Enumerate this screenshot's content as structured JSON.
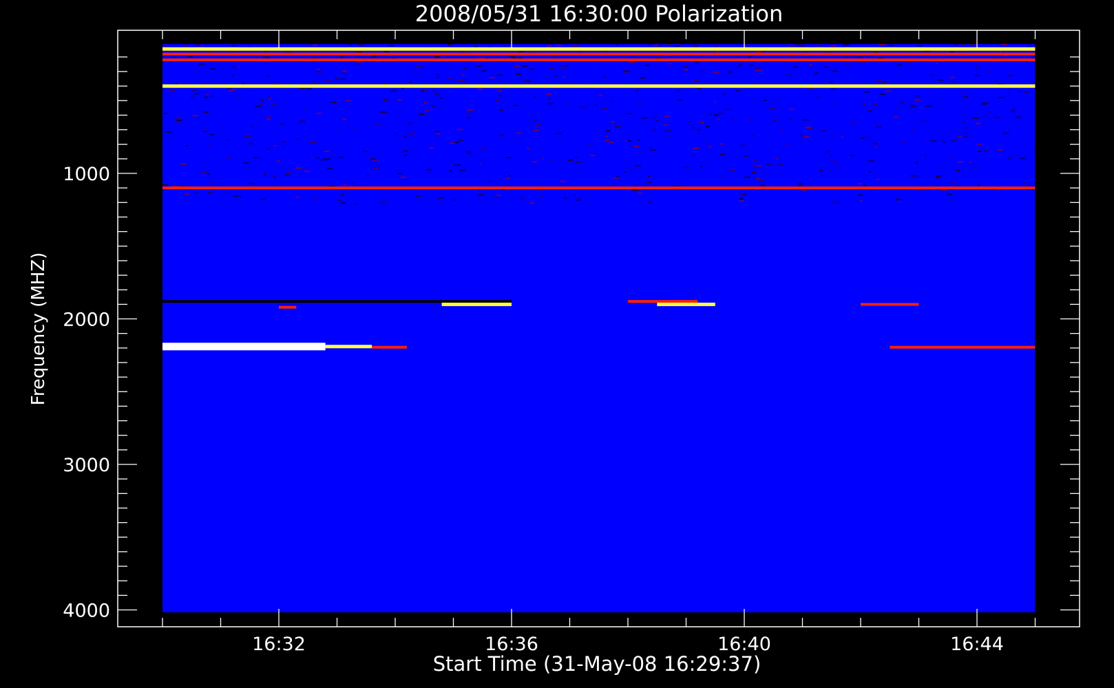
{
  "chart_data": {
    "type": "heatmap",
    "title": "2008/05/31 16:30:00 Polarization",
    "xlabel": "Start Time (31-May-08 16:29:37)",
    "ylabel": "Frequency (MHZ)",
    "x_ticks": [
      "16:32",
      "16:36",
      "16:40",
      "16:44"
    ],
    "y_ticks": [
      1000,
      2000,
      3000,
      4000
    ],
    "xlim_minutes": [
      29.6,
      45.0
    ],
    "ylim": [
      100,
      4020
    ],
    "y_inverted": true,
    "background_color": "#0000ff",
    "colors": {
      "background": "#000000",
      "axes": "#ffffff",
      "low": "#000000",
      "mid": "#ff2000",
      "high": "#ffff40",
      "peak": "#ffffff"
    },
    "bands": [
      {
        "freq": 145,
        "x_start_min": 30.0,
        "x_end_min": 45.0,
        "level": "high"
      },
      {
        "freq": 180,
        "x_start_min": 30.0,
        "x_end_min": 45.0,
        "level": "mid"
      },
      {
        "freq": 220,
        "x_start_min": 30.0,
        "x_end_min": 45.0,
        "level": "mid"
      },
      {
        "freq": 400,
        "x_start_min": 30.0,
        "x_end_min": 45.0,
        "level": "high"
      },
      {
        "freq": 1100,
        "x_start_min": 30.0,
        "x_end_min": 45.0,
        "level": "mid"
      },
      {
        "freq": 1880,
        "x_start_min": 30.0,
        "x_end_min": 36.0,
        "level": "low"
      },
      {
        "freq": 1920,
        "x_start_min": 32.0,
        "x_end_min": 32.3,
        "level": "mid"
      },
      {
        "freq": 1900,
        "x_start_min": 34.8,
        "x_end_min": 36.0,
        "level": "high"
      },
      {
        "freq": 1880,
        "x_start_min": 38.0,
        "x_end_min": 39.2,
        "level": "mid"
      },
      {
        "freq": 1900,
        "x_start_min": 38.5,
        "x_end_min": 39.5,
        "level": "high"
      },
      {
        "freq": 1900,
        "x_start_min": 42.0,
        "x_end_min": 43.0,
        "level": "mid"
      },
      {
        "freq": 2190,
        "x_start_min": 30.0,
        "x_end_min": 32.8,
        "level": "peak"
      },
      {
        "freq": 2190,
        "x_start_min": 32.8,
        "x_end_min": 33.6,
        "level": "high"
      },
      {
        "freq": 2195,
        "x_start_min": 33.6,
        "x_end_min": 34.2,
        "level": "mid"
      },
      {
        "freq": 2195,
        "x_start_min": 42.5,
        "x_end_min": 45.0,
        "level": "mid"
      }
    ]
  }
}
